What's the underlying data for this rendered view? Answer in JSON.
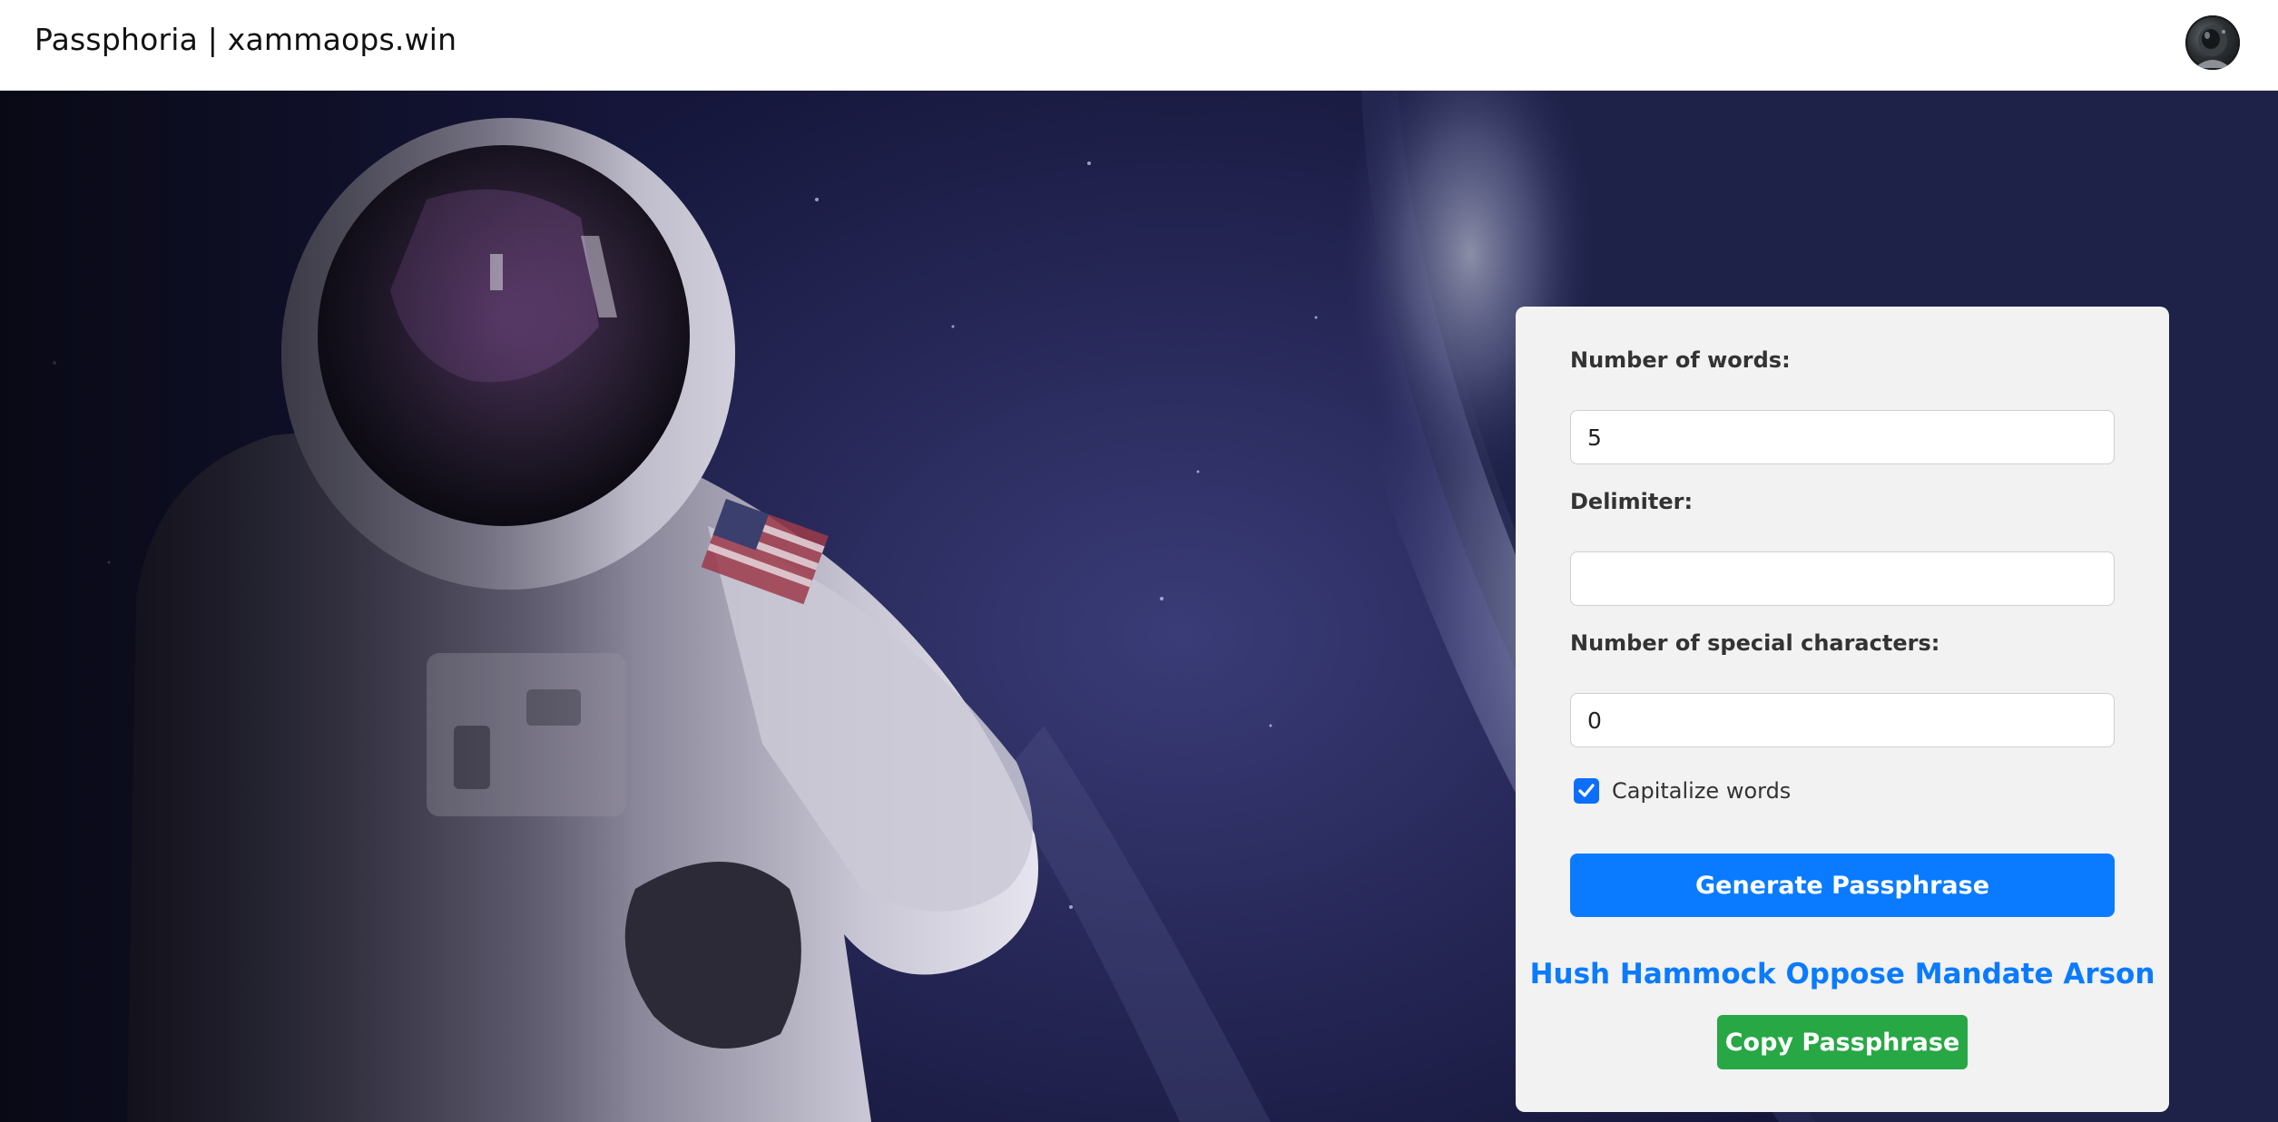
{
  "header": {
    "title": "Passphoria | xammaops.win"
  },
  "form": {
    "words_label": "Number of words:",
    "words_value": "5",
    "delimiter_label": "Delimiter:",
    "delimiter_value": "",
    "special_label": "Number of special characters:",
    "special_value": "0",
    "capitalize_label": "Capitalize words",
    "capitalize_checked": true,
    "generate_label": "Generate Passphrase",
    "result": "Hush Hammock Oppose Mandate Arson",
    "copy_label": "Copy Passphrase"
  },
  "colors": {
    "primary": "#0a7bff",
    "success": "#28a745",
    "card_bg": "#f2f2f2"
  },
  "icons": {
    "avatar": "astronaut-avatar-icon",
    "checkbox": "checkmark-icon"
  }
}
